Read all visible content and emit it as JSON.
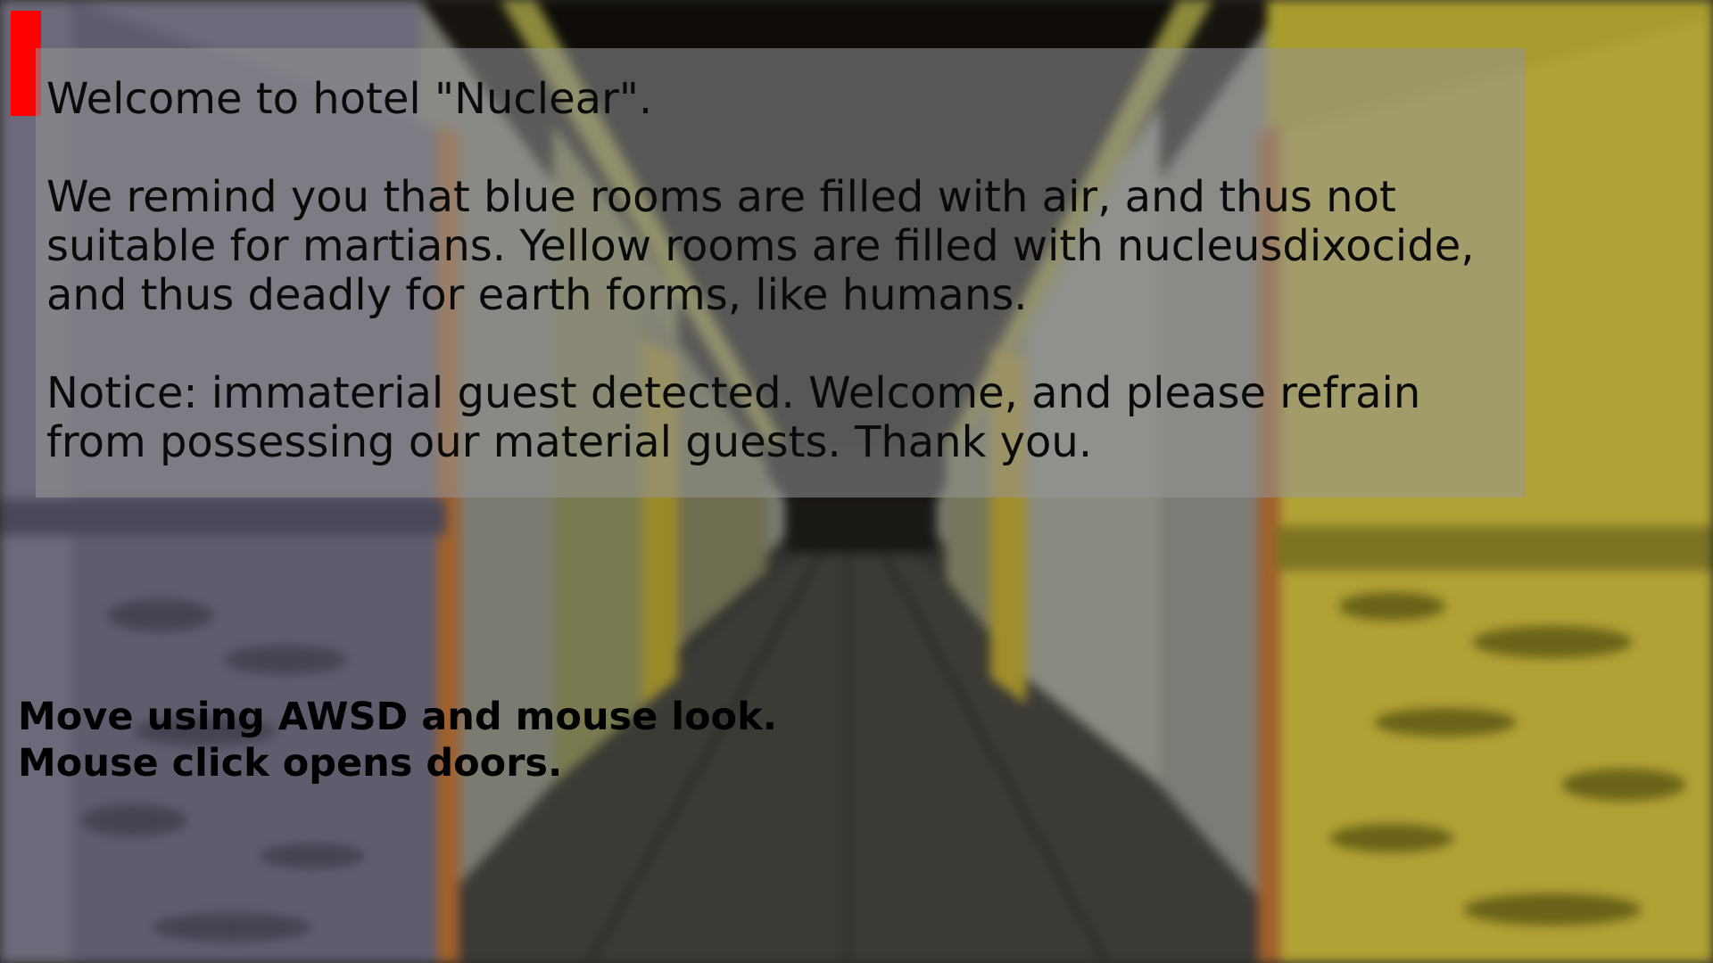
{
  "hud": {
    "health_color": "#ff0000"
  },
  "message": {
    "welcome": "Welcome to hotel \"Nuclear\".",
    "reminder": "We remind you that blue rooms are filled with air, and thus not\nsuitable for martians. Yellow rooms are filled with nucleusdixocide,\nand thus deadly for earth forms, like humans.",
    "notice": "Notice: immaterial guest detected. Welcome, and please refrain\nfrom possessing our material guests. Thank you."
  },
  "controls": {
    "hint": "Move using AWSD and mouse look.\nMouse click opens doors."
  },
  "scene": {
    "left_wall_color": "#6b6878",
    "right_wall_color": "#a59a2c",
    "floor_color": "#3a3a36",
    "ceiling_color": "#120f0c"
  }
}
